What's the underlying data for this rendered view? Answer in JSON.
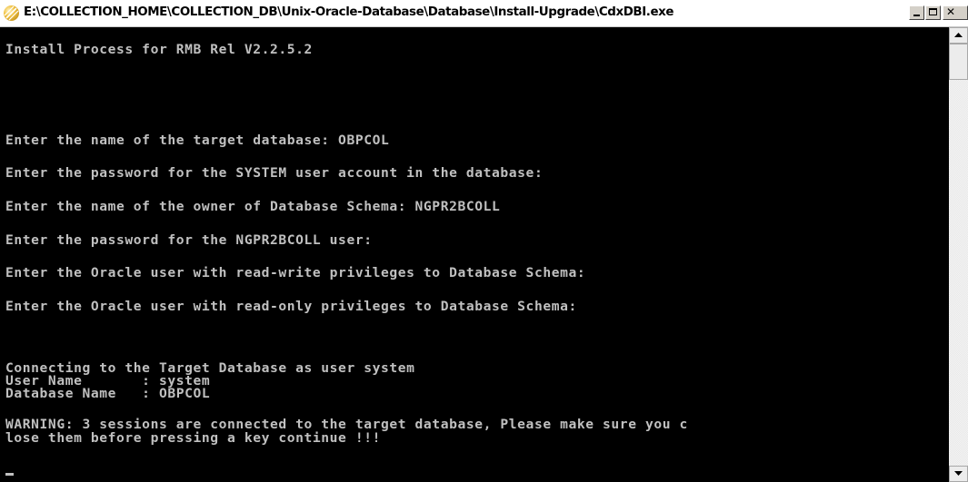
{
  "window": {
    "title": "E:\\COLLECTION_HOME\\COLLECTION_DB\\Unix-Oracle-Database\\Database\\Install-Upgrade\\CdxDBI.exe",
    "buttons": {
      "minimize": "minimize",
      "maximize": "maximize",
      "close": "close"
    }
  },
  "console": {
    "lines": [
      "Install Process for RMB Rel V2.2.5.2",
      "Enter the name of the target database: OBPCOL",
      "Enter the password for the SYSTEM user account in the database:",
      "Enter the name of the owner of Database Schema: NGPR2BCOLL",
      "Enter the password for the NGPR2BCOLL user:",
      "Enter the Oracle user with read-write privileges to Database Schema:",
      "Enter the Oracle user with read-only privileges to Database Schema:",
      "Connecting to the Target Database as user system",
      "User Name       : system",
      "Database Name   : OBPCOL",
      "WARNING: 3 sessions are connected to the target database, Please make sure you c",
      "lose them before pressing a key continue !!!"
    ]
  },
  "colors": {
    "console_background": "#000000",
    "console_text": "#c0c0c0",
    "titlebar_background": "#ffffff"
  },
  "icons": {
    "app": "console-app-icon",
    "scroll_up": "arrow-up-icon",
    "scroll_down": "arrow-down-icon"
  }
}
